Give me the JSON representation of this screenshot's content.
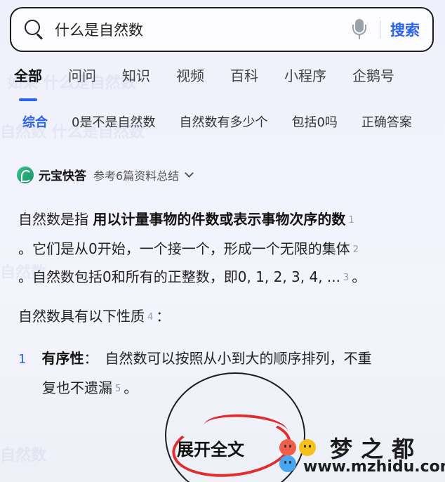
{
  "search": {
    "value": "什么是自然数",
    "button_label": "搜索"
  },
  "tabs": [
    "全部",
    "问问",
    "知识",
    "视频",
    "百科",
    "小程序",
    "企鹅号"
  ],
  "chips": [
    "综合",
    "0是不是自然数",
    "自然数有多少个",
    "包括0吗",
    "正确答案"
  ],
  "ai": {
    "brand": "元宝快答",
    "reference": "参考6篇资料总结"
  },
  "content": {
    "l1_a": "自然数是指 ",
    "l1_b": "用以计量事物的件数或表示事物次序的数",
    "c1": "1",
    "l2": "。它们是从0开始，一个接一个，形成一个无限的集体",
    "c2": "2",
    "l3": "。自然数包括0和所有的正整数，即0, 1, 2, 3, 4, ...",
    "c3": "3",
    "l3_end": "。",
    "l4": "自然数具有以下性质",
    "c4": "4",
    "l4_end": "：",
    "item_num": "1",
    "item_title": "有序性",
    "item_sep": "：",
    "item_text": "自然数可以按照从小到大的顺序排列，不重",
    "item_text2": "复也不遗漏",
    "c5": "5",
    "item_end": "。"
  },
  "expand_label": "展开全文",
  "watermark": {
    "name": "梦之都",
    "url": "www.mzhidu.com"
  },
  "colors": {
    "accent": "#2b63f0",
    "annotation": "#e02d2d"
  }
}
